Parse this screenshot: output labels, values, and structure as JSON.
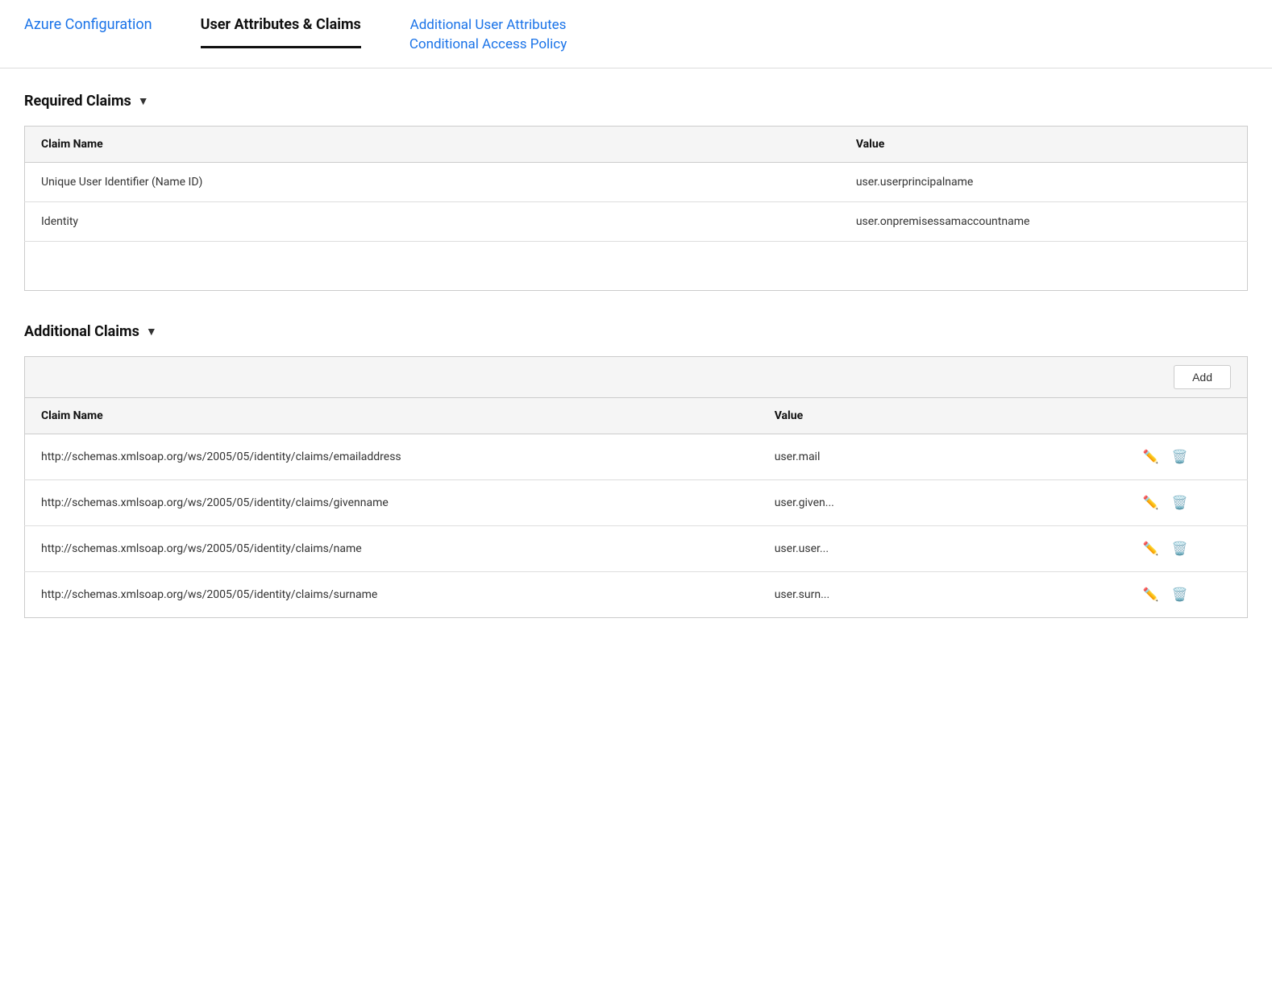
{
  "nav": {
    "tabs": [
      {
        "id": "azure-config",
        "label": "Azure Configuration",
        "active": false
      },
      {
        "id": "user-attributes-claims",
        "label": "User Attributes & Claims",
        "active": true
      },
      {
        "id": "additional-user-attributes",
        "line1": "Additional User Attributes",
        "line2": "Conditional Access Policy",
        "active": false
      }
    ]
  },
  "required_claims": {
    "section_title": "Required Claims",
    "column_claim": "Claim Name",
    "column_value": "Value",
    "rows": [
      {
        "claim": "Unique User Identifier (Name ID)",
        "value": "user.userprincipalname"
      },
      {
        "claim": "Identity",
        "value": "user.onpremisessamaccountname"
      }
    ]
  },
  "additional_claims": {
    "section_title": "Additional Claims",
    "add_button_label": "Add",
    "column_claim": "Claim Name",
    "column_value": "Value",
    "rows": [
      {
        "claim": "http://schemas.xmlsoap.org/ws/2005/05/identity/claims/emailaddress",
        "value": "user.mail"
      },
      {
        "claim": "http://schemas.xmlsoap.org/ws/2005/05/identity/claims/givenname",
        "value": "user.given..."
      },
      {
        "claim": "http://schemas.xmlsoap.org/ws/2005/05/identity/claims/name",
        "value": "user.user..."
      },
      {
        "claim": "http://schemas.xmlsoap.org/ws/2005/05/identity/claims/surname",
        "value": "user.surn..."
      }
    ]
  }
}
